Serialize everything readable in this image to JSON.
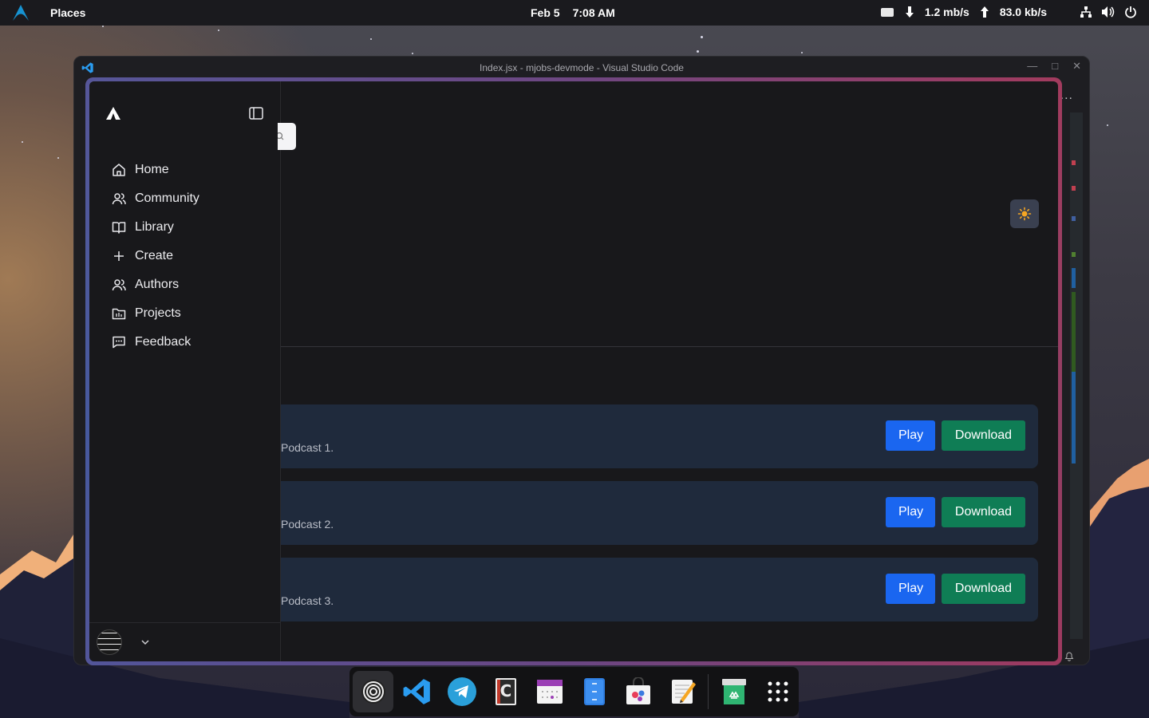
{
  "topbar": {
    "places_label": "Places",
    "date": "Feb 5",
    "time": "7:08 AM",
    "download_speed": "1.2 mb/s",
    "upload_speed": "83.0 kb/s"
  },
  "vscode": {
    "title": "Index.jsx - mjobs-devmode - Visual Studio Code",
    "more_label": "..."
  },
  "sidebar": {
    "items": [
      {
        "label": "Home",
        "icon": "home-icon"
      },
      {
        "label": "Community",
        "icon": "users-icon"
      },
      {
        "label": "Library",
        "icon": "book-icon"
      },
      {
        "label": "Create",
        "icon": "plus-icon"
      },
      {
        "label": "Authors",
        "icon": "users-icon"
      },
      {
        "label": "Projects",
        "icon": "folder-icon"
      },
      {
        "label": "Feedback",
        "icon": "message-icon"
      }
    ]
  },
  "podcasts": [
    {
      "title": "Podcast 1.",
      "play_label": "Play",
      "download_label": "Download"
    },
    {
      "title": "Podcast 2.",
      "play_label": "Play",
      "download_label": "Download"
    },
    {
      "title": "Podcast 3.",
      "play_label": "Play",
      "download_label": "Download"
    }
  ],
  "colors": {
    "play": "#1a66f0",
    "download": "#0f7d55",
    "card": "#1f2a3c",
    "sidebar": "#18181b"
  },
  "dock": {
    "apps": [
      "settings-icon",
      "vscode-icon",
      "telegram-icon",
      "code-editor-icon",
      "calendar-icon",
      "file-manager-icon",
      "software-store-icon",
      "text-editor-icon",
      "trash-icon",
      "app-grid-icon"
    ]
  }
}
